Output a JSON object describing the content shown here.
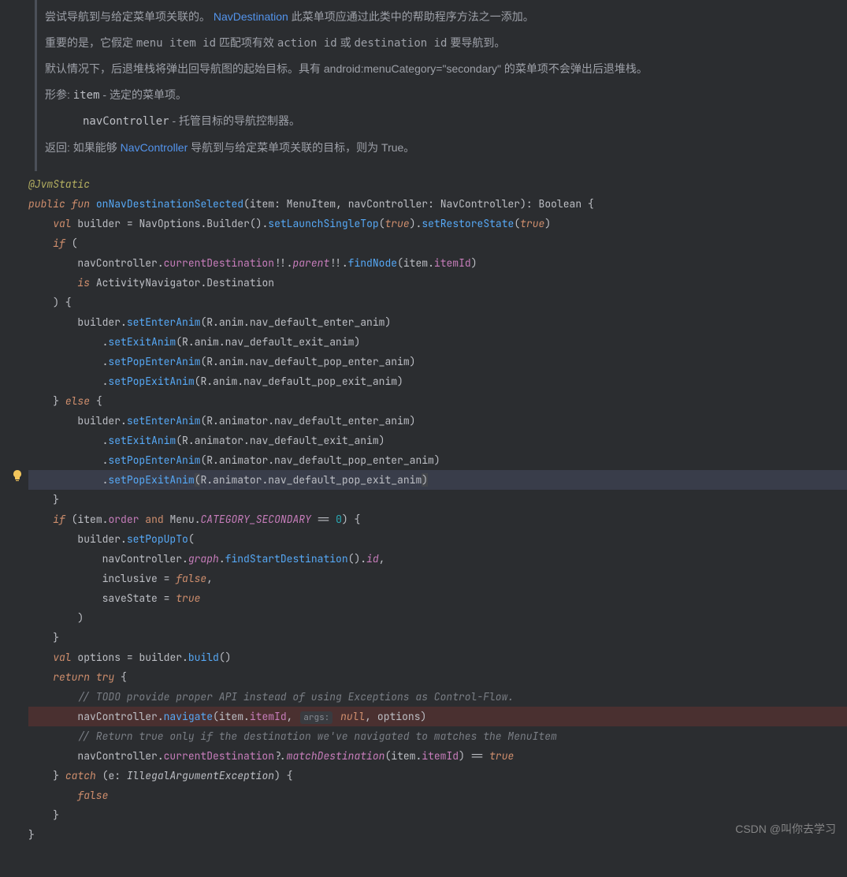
{
  "doc": {
    "p1a": "尝试导航到与给定菜单项关联的。",
    "p1link": "NavDestination",
    "p1b": " 此菜单项应通过此类中的帮助程序方法之一添加。",
    "p2a": "重要的是，它假定 ",
    "p2c1": "menu item id",
    "p2b": " 匹配项有效 ",
    "p2c2": "action id",
    "p2c": " 或 ",
    "p2c3": "destination id",
    "p2d": " 要导航到。",
    "p3": "默认情况下，后退堆栈将弹出回导航图的起始目标。具有 android:menuCategory=\"secondary\" 的菜单项不会弹出后退堆栈。",
    "p4a": "形参: ",
    "p4name1": "item",
    "p4b": " - 选定的菜单项。",
    "p4name2": "navController",
    "p4c": " - 托管目标的导航控制器。",
    "p5a": "返回: 如果能够 ",
    "p5link": "NavController",
    "p5b": " 导航到与给定菜单项关联的目标，则为 True。"
  },
  "code": {
    "l1": {
      "ann": "@JvmStatic"
    },
    "l2": {
      "kw1": "public",
      "kw2": "fun",
      "fn": "onNavDestinationSelected",
      "p1": "item",
      "t1": "MenuItem",
      "p2": "navController",
      "t2": "NavController",
      "t3": "Boolean"
    },
    "l3": {
      "kw": "val",
      "v": "builder",
      "cls": "NavOptions",
      "b": "Builder",
      "m1": "setLaunchSingleTop",
      "b1": "true",
      "m2": "setRestoreState",
      "b2": "true"
    },
    "l4": {
      "kw": "if"
    },
    "l5": {
      "v": "navController",
      "p1": "currentDestination",
      "p2": "parent",
      "m": "findNode",
      "a": "item",
      "p3": "itemId"
    },
    "l6": {
      "kw": "is",
      "t1": "ActivityNavigator",
      "t2": "Destination"
    },
    "l7": {
      "close": ") {"
    },
    "l8": {
      "v": "builder",
      "m": "setEnterAnim",
      "a": "R.anim.nav_default_enter_anim"
    },
    "l9": {
      "m": "setExitAnim",
      "a": "R.anim.nav_default_exit_anim"
    },
    "l10": {
      "m": "setPopEnterAnim",
      "a": "R.anim.nav_default_pop_enter_anim"
    },
    "l11": {
      "m": "setPopExitAnim",
      "a": "R.anim.nav_default_pop_exit_anim"
    },
    "l12": {
      "kw": "else"
    },
    "l13": {
      "v": "builder",
      "m": "setEnterAnim",
      "a": "R.animator.nav_default_enter_anim"
    },
    "l14": {
      "m": "setExitAnim",
      "a": "R.animator.nav_default_exit_anim"
    },
    "l15": {
      "m": "setPopEnterAnim",
      "a": "R.animator.nav_default_pop_enter_anim"
    },
    "l16": {
      "m": "setPopExitAnim",
      "a": "R.animator.nav_default_pop_exit_anim"
    },
    "l18": {
      "kw": "if",
      "v": "item",
      "p": "order",
      "kw2": "and",
      "c": "Menu",
      "cn": "CATEGORY_SECONDARY",
      "n": "0"
    },
    "l19": {
      "v": "builder",
      "m": "setPopUpTo"
    },
    "l20": {
      "v": "navController",
      "p1": "graph",
      "m": "findStartDestination",
      "p2": "id"
    },
    "l21": {
      "a": "inclusive",
      "b": "false"
    },
    "l22": {
      "a": "saveState",
      "b": "true"
    },
    "l25": {
      "kw": "val",
      "v": "options",
      "b": "builder",
      "m": "build"
    },
    "l26": {
      "kw1": "return",
      "kw2": "try"
    },
    "l27": {
      "c": "// TODO provide proper API instead of using Exceptions as Control-Flow."
    },
    "l28": {
      "v": "navController",
      "m": "navigate",
      "a1": "item",
      "p": "itemId",
      "inlay": "args:",
      "n": "null",
      "a2": "options"
    },
    "l29": {
      "c": "// Return true only if the destination we've navigated to matches the MenuItem"
    },
    "l30": {
      "v": "navController",
      "p": "currentDestination",
      "m": "matchDestination",
      "a": "item",
      "p2": "itemId",
      "b": "true"
    },
    "l31": {
      "kw": "catch",
      "e": "e",
      "t": "IllegalArgumentException"
    },
    "l32": {
      "b": "false"
    }
  },
  "watermark": "CSDN @叫你去学习"
}
